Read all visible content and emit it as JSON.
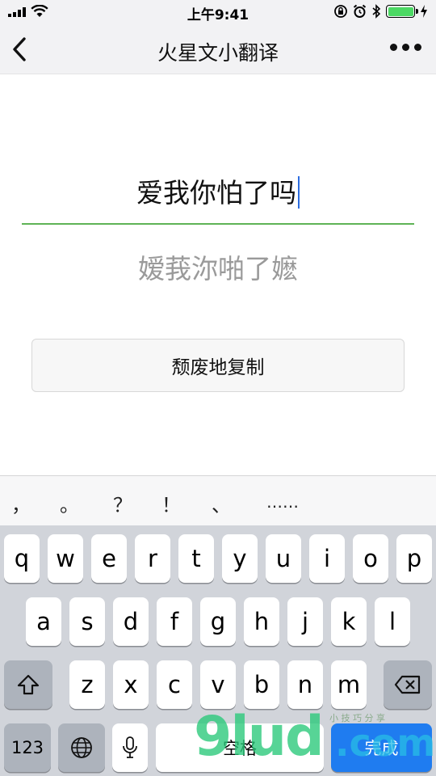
{
  "status_bar": {
    "time": "上午9:41"
  },
  "nav": {
    "title": "火星文小翻译"
  },
  "translator": {
    "input_value": "爱我你怕了吗",
    "output_value": "嫒莪沵啪了嬷",
    "copy_label": "颓废地复制"
  },
  "punctuation": [
    "，",
    "。",
    "？",
    "！",
    "、",
    "……"
  ],
  "keyboard": {
    "row1": [
      "q",
      "w",
      "e",
      "r",
      "t",
      "y",
      "u",
      "i",
      "o",
      "p"
    ],
    "row2": [
      "a",
      "s",
      "d",
      "f",
      "g",
      "h",
      "j",
      "k",
      "l"
    ],
    "row3": [
      "z",
      "x",
      "c",
      "v",
      "b",
      "n",
      "m"
    ],
    "num_label": "123",
    "space_label": "空格",
    "done_label": "完成"
  },
  "watermark": {
    "main": "9lud",
    "domain": ".com",
    "small": "小  技  巧  分  享"
  },
  "colors": {
    "accent_green": "#5fb356",
    "done_blue": "#1f7cf0",
    "battery_green": "#4cd964"
  }
}
